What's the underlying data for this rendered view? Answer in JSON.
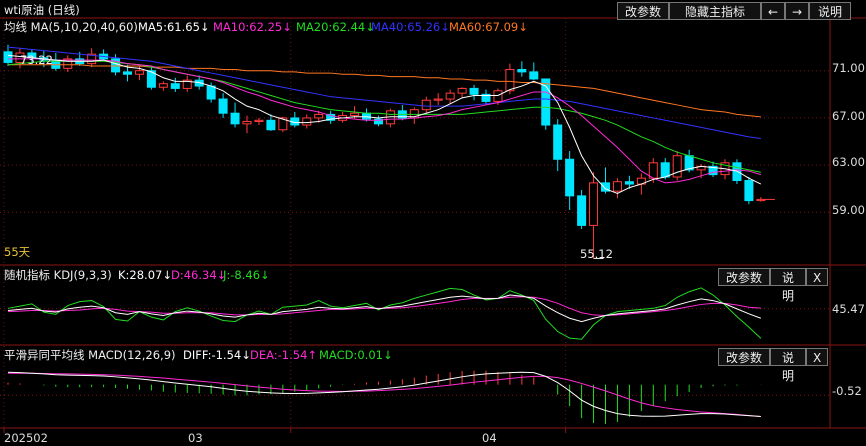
{
  "header": {
    "title": "wti原油 (日线)",
    "buttons": [
      "改参数",
      "隐藏主指标",
      "←",
      "→",
      "说明"
    ]
  },
  "main_panel": {
    "ma_label": "均线 MA(5,10,20,40,60)",
    "ma5": "MA5:61.65↓",
    "ma10": "MA10:62.25↓",
    "ma20": "MA20:62.44↓",
    "ma40": "MA40:65.26↓",
    "ma60": "MA60:67.09↓",
    "y_ticks": [
      "71.00",
      "67.00",
      "63.00",
      "59.00"
    ],
    "high_annot": "73.22",
    "low_annot": "55.12",
    "period_note": "55天"
  },
  "kdj_panel": {
    "title": "随机指标 KDJ(9,3,3)",
    "k": "K:28.07↓",
    "d": "D:46.34↓",
    "j": "J:-8.46↓",
    "buttons": [
      "改参数",
      "说明",
      "X"
    ],
    "y_tick": "45.47"
  },
  "macd_panel": {
    "title": "平滑异同平均线 MACD(12,26,9)",
    "diff": "DIFF:-1.54↓",
    "dea": "DEA:-1.54↑",
    "macd": "MACD:0.01↓",
    "buttons": [
      "改参数",
      "说明",
      "X"
    ],
    "y_tick": "-0.52"
  },
  "x_ticks": [
    "202502",
    "03",
    "04"
  ],
  "colors": {
    "up": "#ff3b3b",
    "down": "#00e5ff",
    "ma5": "#ffffff",
    "ma10": "#ff2bd4",
    "ma20": "#22dd22",
    "ma40": "#3333ff",
    "ma60": "#ff7722",
    "grid": "#7a1111"
  },
  "chart_data": {
    "type": "candlestick",
    "ohlc": [
      [
        72.6,
        73.2,
        71.4,
        71.7
      ],
      [
        71.7,
        72.9,
        71.2,
        72.5
      ],
      [
        72.5,
        72.8,
        71.6,
        72.1
      ],
      [
        72.1,
        72.7,
        71.3,
        71.9
      ],
      [
        71.9,
        72.5,
        71.0,
        71.2
      ],
      [
        71.2,
        72.3,
        70.9,
        72.0
      ],
      [
        72.0,
        72.6,
        71.4,
        71.6
      ],
      [
        71.6,
        72.9,
        71.3,
        72.4
      ],
      [
        72.4,
        72.8,
        71.8,
        72.0
      ],
      [
        72.0,
        72.4,
        70.6,
        70.9
      ],
      [
        70.9,
        71.5,
        70.1,
        70.7
      ],
      [
        70.7,
        71.4,
        70.2,
        71.0
      ],
      [
        71.0,
        71.3,
        69.4,
        69.6
      ],
      [
        69.6,
        70.1,
        69.3,
        69.9
      ],
      [
        69.9,
        70.4,
        69.2,
        69.5
      ],
      [
        69.5,
        70.6,
        69.2,
        70.2
      ],
      [
        70.2,
        70.6,
        69.4,
        69.7
      ],
      [
        69.7,
        70.0,
        68.3,
        68.6
      ],
      [
        68.6,
        69.1,
        67.0,
        67.4
      ],
      [
        67.4,
        68.3,
        66.2,
        66.5
      ],
      [
        66.5,
        67.2,
        65.7,
        66.7
      ],
      [
        66.7,
        67.0,
        66.4,
        66.8
      ],
      [
        66.8,
        67.3,
        65.9,
        66.0
      ],
      [
        66.0,
        67.1,
        65.8,
        67.0
      ],
      [
        67.0,
        67.5,
        66.2,
        66.4
      ],
      [
        66.4,
        67.3,
        66.1,
        67.0
      ],
      [
        67.0,
        67.6,
        66.6,
        67.3
      ],
      [
        67.3,
        67.6,
        66.5,
        66.8
      ],
      [
        66.8,
        67.5,
        66.6,
        67.2
      ],
      [
        67.2,
        68.0,
        66.9,
        67.4
      ],
      [
        67.4,
        67.8,
        66.7,
        66.9
      ],
      [
        66.9,
        67.2,
        66.3,
        66.5
      ],
      [
        66.5,
        67.8,
        66.2,
        67.6
      ],
      [
        67.6,
        68.1,
        66.8,
        67.0
      ],
      [
        67.0,
        67.9,
        66.5,
        67.7
      ],
      [
        67.7,
        68.8,
        67.4,
        68.5
      ],
      [
        68.5,
        69.1,
        68.1,
        68.6
      ],
      [
        68.6,
        69.4,
        68.2,
        69.1
      ],
      [
        69.1,
        69.6,
        68.7,
        69.5
      ],
      [
        69.5,
        69.8,
        68.5,
        69.0
      ],
      [
        69.0,
        69.4,
        68.1,
        68.4
      ],
      [
        68.4,
        69.5,
        68.1,
        69.3
      ],
      [
        69.3,
        71.6,
        69.0,
        71.1
      ],
      [
        71.1,
        71.8,
        70.5,
        70.9
      ],
      [
        70.9,
        71.7,
        70.2,
        70.3
      ],
      [
        70.3,
        69.9,
        66.0,
        66.4
      ],
      [
        66.4,
        66.9,
        62.5,
        63.5
      ],
      [
        63.5,
        64.2,
        59.2,
        60.4
      ],
      [
        60.4,
        60.9,
        57.6,
        57.9
      ],
      [
        57.9,
        62.4,
        55.1,
        61.5
      ],
      [
        61.5,
        62.8,
        60.6,
        60.8
      ],
      [
        60.8,
        61.9,
        60.2,
        61.6
      ],
      [
        61.6,
        62.1,
        61.0,
        61.4
      ],
      [
        61.4,
        62.3,
        60.5,
        61.9
      ],
      [
        61.9,
        63.6,
        61.5,
        63.2
      ],
      [
        63.2,
        63.6,
        61.8,
        62.0
      ],
      [
        62.0,
        64.2,
        61.7,
        63.8
      ],
      [
        63.8,
        64.3,
        62.4,
        62.6
      ],
      [
        62.6,
        63.1,
        61.9,
        62.9
      ],
      [
        62.9,
        63.3,
        62.0,
        62.2
      ],
      [
        62.2,
        63.5,
        61.8,
        63.2
      ],
      [
        63.2,
        63.5,
        61.4,
        61.7
      ],
      [
        61.7,
        62.0,
        59.7,
        60.0
      ],
      [
        60.0,
        60.3,
        59.9,
        60.1
      ]
    ],
    "ma5": [
      72.3,
      72.2,
      72.1,
      72.0,
      71.9,
      71.8,
      71.8,
      71.8,
      71.9,
      71.6,
      71.3,
      71.2,
      70.9,
      70.4,
      70.1,
      70.1,
      70.0,
      69.7,
      69.3,
      68.6,
      68.0,
      67.7,
      67.2,
      66.9,
      66.6,
      66.6,
      66.7,
      66.9,
      67.0,
      67.1,
      67.1,
      67.0,
      67.1,
      67.1,
      67.1,
      67.4,
      67.7,
      68.2,
      68.7,
      68.9,
      68.9,
      68.9,
      69.4,
      69.7,
      70.1,
      69.7,
      68.3,
      66.2,
      63.8,
      62.1,
      61.0,
      60.6,
      61.1,
      61.4,
      61.8,
      62.0,
      62.4,
      62.7,
      62.9,
      62.8,
      62.7,
      62.5,
      61.9,
      61.4
    ],
    "ma10": [
      72.0,
      72.0,
      72.0,
      72.0,
      71.9,
      71.9,
      71.9,
      71.9,
      71.9,
      71.8,
      71.6,
      71.5,
      71.4,
      71.1,
      70.9,
      70.7,
      70.5,
      70.3,
      70.0,
      69.6,
      69.2,
      68.9,
      68.5,
      68.2,
      67.9,
      67.7,
      67.5,
      67.2,
      67.0,
      66.9,
      66.8,
      66.8,
      66.9,
      66.9,
      67.0,
      67.1,
      67.2,
      67.4,
      67.7,
      67.9,
      68.1,
      68.3,
      68.6,
      68.9,
      69.2,
      69.2,
      68.7,
      68.0,
      67.2,
      66.3,
      65.4,
      64.5,
      63.5,
      62.5,
      61.9,
      61.5,
      61.6,
      61.8,
      62.1,
      62.4,
      62.5,
      62.6,
      62.5,
      62.2
    ],
    "ma20": [
      71.5,
      71.6,
      71.7,
      71.8,
      71.8,
      71.8,
      71.8,
      71.8,
      71.8,
      71.7,
      71.6,
      71.5,
      71.3,
      71.1,
      70.9,
      70.7,
      70.5,
      70.3,
      70.1,
      69.8,
      69.5,
      69.2,
      68.9,
      68.6,
      68.3,
      68.1,
      67.9,
      67.7,
      67.6,
      67.5,
      67.4,
      67.4,
      67.3,
      67.3,
      67.3,
      67.3,
      67.3,
      67.3,
      67.3,
      67.4,
      67.5,
      67.6,
      67.7,
      67.8,
      67.9,
      67.9,
      67.8,
      67.6,
      67.4,
      67.1,
      66.8,
      66.4,
      65.9,
      65.4,
      65.0,
      64.5,
      64.1,
      63.8,
      63.5,
      63.2,
      63.0,
      62.8,
      62.6,
      62.4
    ],
    "ma40": [
      73.0,
      72.9,
      72.8,
      72.7,
      72.6,
      72.5,
      72.4,
      72.3,
      72.2,
      72.1,
      72.0,
      71.9,
      71.8,
      71.6,
      71.4,
      71.2,
      71.0,
      70.8,
      70.6,
      70.4,
      70.2,
      70.0,
      69.8,
      69.6,
      69.4,
      69.2,
      69.0,
      68.8,
      68.7,
      68.6,
      68.5,
      68.4,
      68.3,
      68.2,
      68.1,
      68.0,
      68.0,
      68.0,
      68.0,
      68.1,
      68.2,
      68.3,
      68.4,
      68.5,
      68.6,
      68.6,
      68.5,
      68.4,
      68.2,
      68.0,
      67.8,
      67.6,
      67.4,
      67.2,
      67.0,
      66.8,
      66.6,
      66.4,
      66.2,
      66.0,
      65.8,
      65.6,
      65.4,
      65.26
    ],
    "ma60": [
      71.5,
      71.5,
      71.5,
      71.5,
      71.5,
      71.5,
      71.5,
      71.4,
      71.4,
      71.4,
      71.4,
      71.4,
      71.3,
      71.3,
      71.3,
      71.2,
      71.2,
      71.2,
      71.1,
      71.1,
      71.0,
      71.0,
      71.0,
      70.9,
      70.9,
      70.8,
      70.8,
      70.8,
      70.7,
      70.7,
      70.6,
      70.6,
      70.5,
      70.5,
      70.5,
      70.4,
      70.4,
      70.3,
      70.3,
      70.2,
      70.2,
      70.1,
      70.1,
      70.0,
      70.0,
      69.9,
      69.8,
      69.7,
      69.6,
      69.5,
      69.3,
      69.1,
      68.9,
      68.7,
      68.5,
      68.3,
      68.1,
      67.9,
      67.7,
      67.6,
      67.5,
      67.3,
      67.2,
      67.09
    ],
    "kdj_k": [
      42,
      44,
      46,
      41,
      39,
      45,
      48,
      50,
      47,
      38,
      35,
      40,
      36,
      33,
      38,
      41,
      39,
      36,
      32,
      30,
      34,
      37,
      35,
      40,
      42,
      44,
      48,
      46,
      45,
      47,
      49,
      45,
      48,
      50,
      54,
      58,
      62,
      66,
      68,
      66,
      63,
      64,
      70,
      68,
      64,
      50,
      38,
      28,
      22,
      28,
      33,
      36,
      38,
      40,
      42,
      45,
      52,
      58,
      63,
      60,
      54,
      45,
      36,
      28
    ],
    "kdj_d": [
      40,
      41,
      42,
      42,
      41,
      42,
      43,
      45,
      46,
      44,
      41,
      40,
      39,
      37,
      37,
      38,
      38,
      38,
      36,
      34,
      34,
      35,
      35,
      36,
      38,
      40,
      42,
      44,
      44,
      45,
      46,
      46,
      46,
      47,
      49,
      52,
      55,
      58,
      62,
      64,
      64,
      64,
      66,
      67,
      66,
      62,
      55,
      46,
      38,
      34,
      33,
      34,
      36,
      38,
      40,
      42,
      45,
      49,
      53,
      55,
      55,
      52,
      48,
      46.34
    ],
    "kdj_j": [
      46,
      50,
      54,
      39,
      35,
      51,
      58,
      60,
      49,
      26,
      23,
      40,
      30,
      25,
      40,
      47,
      41,
      32,
      24,
      22,
      34,
      41,
      35,
      48,
      50,
      52,
      60,
      50,
      47,
      51,
      55,
      43,
      52,
      56,
      64,
      70,
      76,
      82,
      80,
      70,
      61,
      64,
      78,
      70,
      60,
      26,
      4,
      -8,
      -10,
      16,
      33,
      40,
      42,
      44,
      46,
      51,
      66,
      76,
      83,
      70,
      52,
      31,
      12,
      -8.46
    ],
    "macd_diff": [
      0.6,
      0.58,
      0.55,
      0.52,
      0.48,
      0.46,
      0.45,
      0.44,
      0.42,
      0.38,
      0.33,
      0.28,
      0.22,
      0.15,
      0.08,
      0.02,
      -0.04,
      -0.1,
      -0.18,
      -0.26,
      -0.32,
      -0.36,
      -0.4,
      -0.42,
      -0.43,
      -0.42,
      -0.4,
      -0.37,
      -0.34,
      -0.3,
      -0.26,
      -0.22,
      -0.16,
      -0.1,
      -0.02,
      0.08,
      0.18,
      0.28,
      0.38,
      0.46,
      0.52,
      0.55,
      0.58,
      0.6,
      0.58,
      0.4,
      0.1,
      -0.3,
      -0.75,
      -1.05,
      -1.25,
      -1.4,
      -1.48,
      -1.52,
      -1.53,
      -1.52,
      -1.48,
      -1.44,
      -1.4,
      -1.4,
      -1.42,
      -1.46,
      -1.5,
      -1.54
    ],
    "macd_dea": [
      0.55,
      0.55,
      0.55,
      0.54,
      0.53,
      0.52,
      0.51,
      0.5,
      0.48,
      0.46,
      0.43,
      0.4,
      0.36,
      0.32,
      0.27,
      0.22,
      0.17,
      0.12,
      0.06,
      0.0,
      -0.06,
      -0.12,
      -0.17,
      -0.22,
      -0.26,
      -0.29,
      -0.31,
      -0.32,
      -0.33,
      -0.32,
      -0.31,
      -0.29,
      -0.26,
      -0.23,
      -0.19,
      -0.14,
      -0.08,
      -0.02,
      0.05,
      0.12,
      0.18,
      0.24,
      0.3,
      0.36,
      0.4,
      0.4,
      0.34,
      0.22,
      0.06,
      -0.12,
      -0.3,
      -0.5,
      -0.7,
      -0.88,
      -1.02,
      -1.12,
      -1.2,
      -1.26,
      -1.32,
      -1.36,
      -1.4,
      -1.44,
      -1.5,
      -1.54
    ],
    "macd_hist": [
      0.1,
      0.06,
      0.0,
      -0.04,
      -0.1,
      -0.12,
      -0.12,
      -0.12,
      -0.12,
      -0.16,
      -0.2,
      -0.24,
      -0.28,
      -0.34,
      -0.38,
      -0.4,
      -0.42,
      -0.44,
      -0.48,
      -0.52,
      -0.52,
      -0.48,
      -0.46,
      -0.4,
      -0.34,
      -0.26,
      -0.18,
      -0.1,
      -0.02,
      0.04,
      0.1,
      0.14,
      0.2,
      0.26,
      0.34,
      0.44,
      0.52,
      0.6,
      0.66,
      0.68,
      0.68,
      0.62,
      0.56,
      0.48,
      0.36,
      0.0,
      -0.48,
      -1.04,
      -1.62,
      -1.86,
      -1.9,
      -1.8,
      -1.56,
      -1.28,
      -1.02,
      -0.8,
      -0.56,
      -0.36,
      -0.16,
      -0.08,
      -0.04,
      -0.04,
      0.0,
      0.01
    ],
    "x_tick_index": [
      0,
      24,
      47
    ]
  }
}
